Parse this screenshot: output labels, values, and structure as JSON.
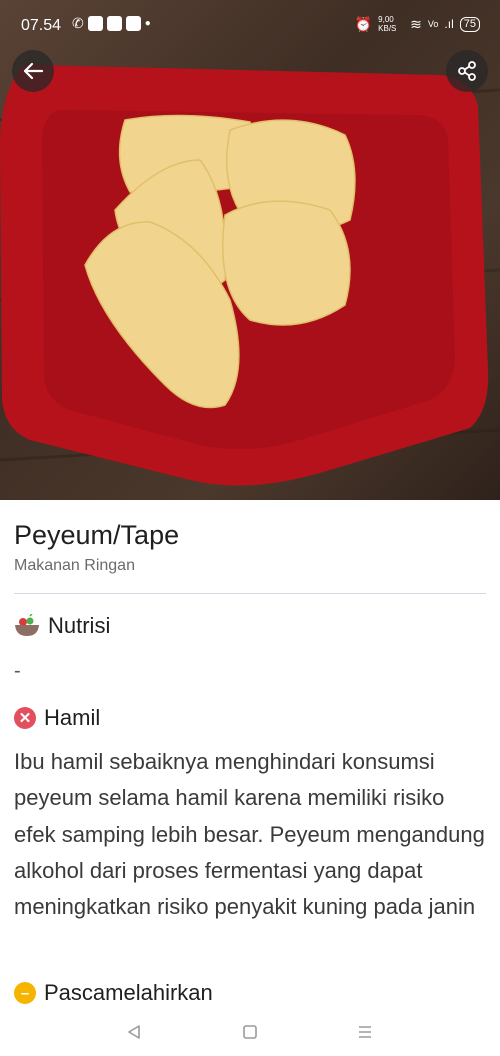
{
  "status_bar": {
    "time": "07.54",
    "net_speed": "9,00 KB/S",
    "battery": "75"
  },
  "food": {
    "title": "Peyeum/Tape",
    "category": "Makanan Ringan"
  },
  "sections": {
    "nutrisi": {
      "label": "Nutrisi",
      "content": "-",
      "icon": "bowl-icon"
    },
    "hamil": {
      "label": "Hamil",
      "status_icon": "x-circle-icon",
      "status_color": "#e24f5e",
      "text": "Ibu hamil sebaiknya menghindari konsumsi peyeum selama hamil karena memiliki risiko efek samping lebih besar. Peyeum mengandung alkohol dari proses fermentasi yang dapat meningkatkan risiko penyakit kuning pada janin"
    },
    "pascamelahirkan": {
      "label": "Pascamelahirkan",
      "status_icon": "minus-circle-icon",
      "status_color": "#f4b400"
    }
  },
  "colors": {
    "plate": "#b5121b",
    "food": "#f1d58f"
  }
}
